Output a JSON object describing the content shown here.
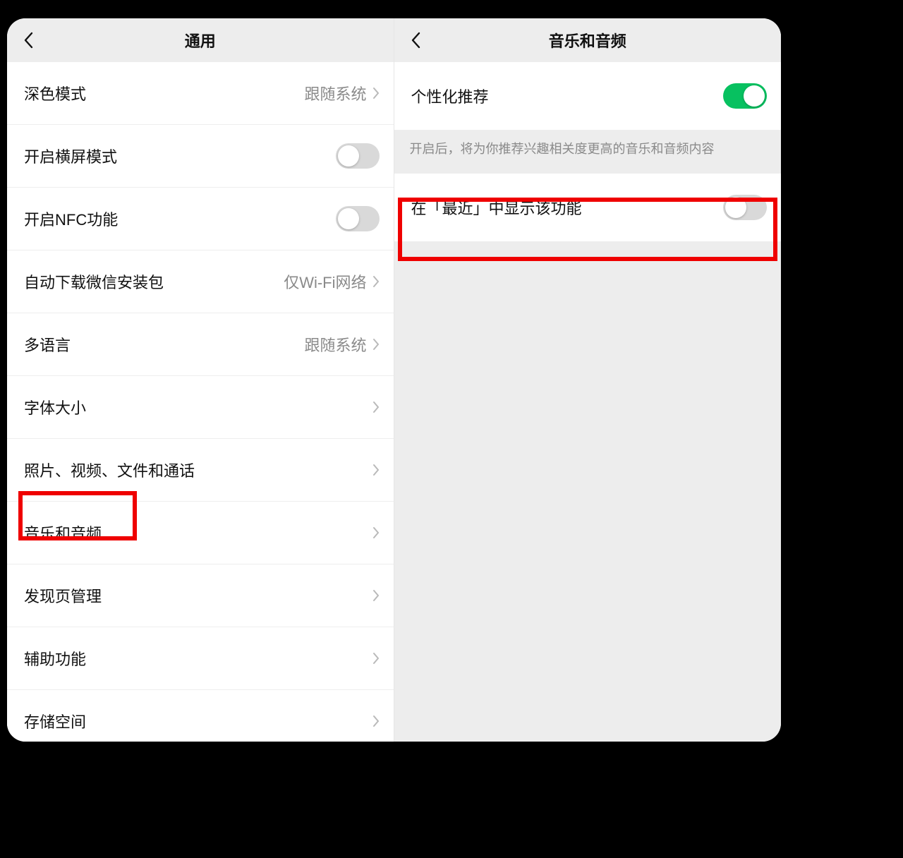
{
  "left": {
    "title": "通用",
    "rows": {
      "dark": {
        "label": "深色模式",
        "value": "跟随系统"
      },
      "land": {
        "label": "开启横屏模式"
      },
      "nfc": {
        "label": "开启NFC功能"
      },
      "dl": {
        "label": "自动下载微信安装包",
        "value": "仅Wi-Fi网络"
      },
      "lang": {
        "label": "多语言",
        "value": "跟随系统"
      },
      "font": {
        "label": "字体大小"
      },
      "media": {
        "label": "照片、视频、文件和通话"
      },
      "music": {
        "label": "音乐和音频"
      },
      "disc": {
        "label": "发现页管理"
      },
      "access": {
        "label": "辅助功能"
      },
      "store": {
        "label": "存储空间"
      }
    }
  },
  "right": {
    "title": "音乐和音频",
    "personalize": {
      "label": "个性化推荐",
      "on": true
    },
    "desc": "开启后，将为你推荐兴趣相关度更高的音乐和音频内容",
    "showRecent": {
      "label": "在「最近」中显示该功能",
      "on": false
    }
  }
}
